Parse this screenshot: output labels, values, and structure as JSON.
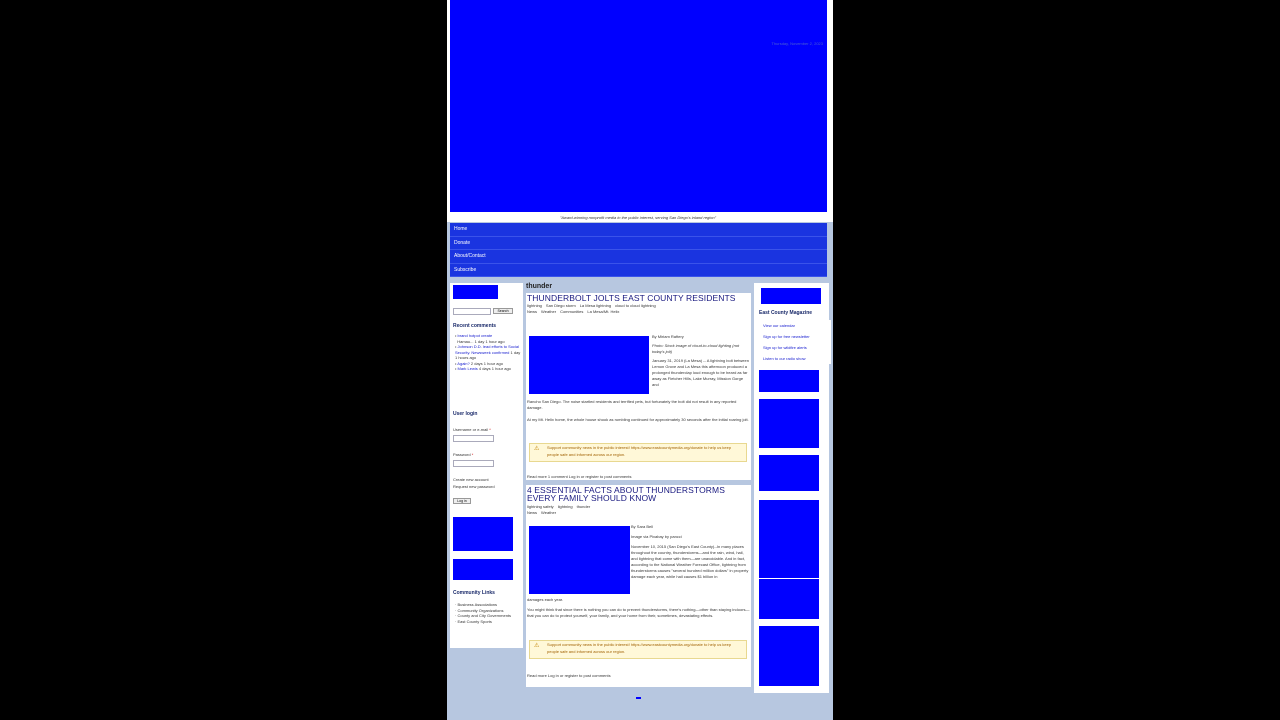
{
  "header": {
    "date": "Thursday, November 2, 2023",
    "tagline": "\"Award-winning nonprofit media in the public interest, serving San Diego's inland region\""
  },
  "nav": {
    "items": [
      {
        "label": "Home"
      },
      {
        "label": "Donate"
      },
      {
        "label": "About/Contact"
      },
      {
        "label": "Subscribe"
      }
    ]
  },
  "search": {
    "button_label": "Search"
  },
  "recent_comments": {
    "title": "Recent comments",
    "items": [
      {
        "text": "brand hotpot create",
        "meta": "Hamau... 1 day 1 hour ago"
      },
      {
        "text": "Johnson D.D. lead efforts to Social Security. Newsweek confirmed",
        "meta": "1 day 1 hours ago"
      },
      {
        "text": "Again?",
        "meta": "2 days 1 hour ago"
      },
      {
        "text": "Mark Lewis",
        "meta": "4 days 1 hour ago"
      }
    ]
  },
  "login": {
    "title": "User login",
    "username_label": "Username or e-mail",
    "password_label": "Password",
    "create_account": "Create new account",
    "request_password": "Request new password",
    "login_button": "Log in"
  },
  "community_links": {
    "title": "Community Links",
    "items": [
      {
        "label": "Business Associations"
      },
      {
        "label": "Community Organizations"
      },
      {
        "label": "County and City Governments"
      },
      {
        "label": "East County Sports"
      }
    ]
  },
  "main": {
    "section_title": "thunder",
    "articles": [
      {
        "title": "THUNDERBOLT JOLTS EAST COUNTY RESIDENTS",
        "tags": [
          "lightning",
          "San Diego storm",
          "La Mesa lightning",
          "cloud to cloud lightning"
        ],
        "cats": [
          "News",
          "Weather",
          "Communities",
          "La Mesa/Mt. Helix"
        ],
        "byline": "By Miriam Raftery",
        "caption": "Photo: Stock image of cloud-to-cloud lighting (not today's jolt)",
        "text1": "January 31, 2019 (La Mesa) -- A lightning bolt between Lemon Grove and La Mesa this afternoon produced a prolonged thunderclap loud enough to be heard as far away as Fletcher Hills, Lake Murray, Mission Gorge and",
        "text2": "Rancho San Diego. The noise startled residents and terrified pets, but fortunately the bolt did not result in any reported damage.",
        "text3": "At my Mt. Helix home, the whole house shook as rumbling continued for approximately 30 seconds after the initial roaring jolt.",
        "support": "Support community news in the public interest! https://www.eastcountymedia.org/donate to help us keep people safe and informed across our region.",
        "footer": "Read more   1 comment   Log in or register to post comments"
      },
      {
        "title": "4 ESSENTIAL FACTS ABOUT THUNDERSTORMS EVERY FAMILY SHOULD KNOW",
        "tags": [
          "lightning safety",
          "lightning",
          "thunder"
        ],
        "cats": [
          "News",
          "Weather"
        ],
        "byline": "By Sara Bell",
        "caption": "Image via Pixabay by pancci",
        "text1": "November 10, 2015 (San Diego's East County)--In many places throughout the country, thunderstorms—and the rain, wind, hail, and lightning that come with them—are unavoidable. And in fact, according to the National Weather Forecast Office, lightning from thunderstorms causes \"several hundred million dollars\" in property damage each year, while hail causes $1 billion in",
        "text2": "damages each year.",
        "text3": "You might think that since there is nothing you can do to prevent thunderstorms, there's nothing—other than staying indoors—that you can do to protect yourself, your family, and your home from their, sometimes, devastating effects.",
        "support": "Support community news in the public interest! https://www.eastcountymedia.org/donate to help us keep people safe and informed across our region.",
        "footer": "Read more   Log in or register to post comments"
      }
    ]
  },
  "right": {
    "title": "East County Magazine",
    "items": [
      {
        "label": "View our calendar"
      },
      {
        "label": "Sign up for free newsletter"
      },
      {
        "label": "Sign up for wildfire alerts"
      },
      {
        "label": "Listen to our radio show"
      }
    ]
  },
  "colors": {
    "placeholder": "#0000ff",
    "nav": "#1a34e0",
    "page_bg": "#b7c7e0"
  }
}
